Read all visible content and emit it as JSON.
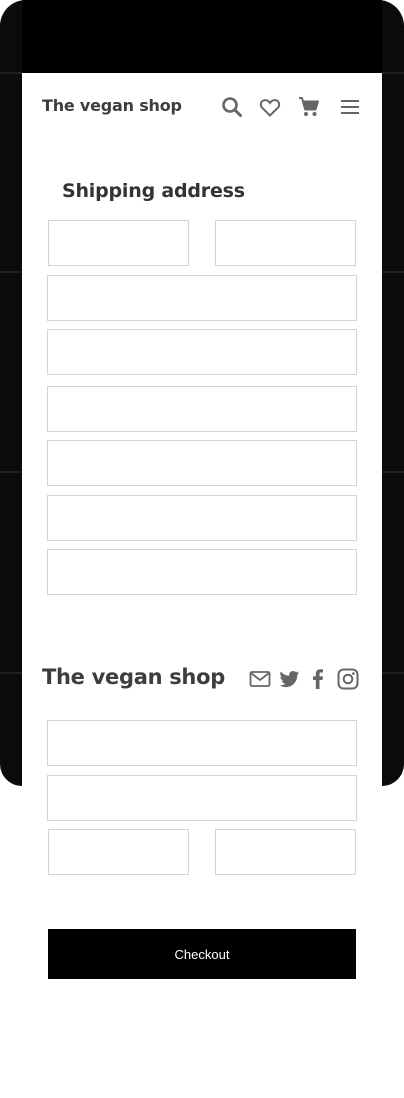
{
  "header": {
    "brand": "The vegan shop",
    "icons": [
      "search-icon",
      "heart-icon",
      "cart-icon",
      "menu-icon"
    ]
  },
  "shipping": {
    "title": "Shipping address",
    "fields": [
      {
        "value": "",
        "placeholder": ""
      },
      {
        "value": "",
        "placeholder": ""
      },
      {
        "value": "",
        "placeholder": ""
      },
      {
        "value": "",
        "placeholder": ""
      },
      {
        "value": "",
        "placeholder": ""
      },
      {
        "value": "",
        "placeholder": ""
      },
      {
        "value": "",
        "placeholder": ""
      },
      {
        "value": "",
        "placeholder": ""
      }
    ]
  },
  "footer": {
    "brand": "The vegan shop",
    "social_icons": [
      "mail-icon",
      "twitter-icon",
      "facebook-icon",
      "instagram-icon"
    ]
  },
  "payment": {
    "fields": [
      {
        "value": "",
        "placeholder": ""
      },
      {
        "value": "",
        "placeholder": ""
      },
      {
        "value": "",
        "placeholder": ""
      },
      {
        "value": "",
        "placeholder": ""
      }
    ]
  },
  "checkout": {
    "label": "Checkout"
  },
  "colors": {
    "text": "#3d3d3d",
    "icon": "#666666",
    "border": "#d4d4d4",
    "button": "#000000",
    "frame": "#0b0b0b"
  }
}
